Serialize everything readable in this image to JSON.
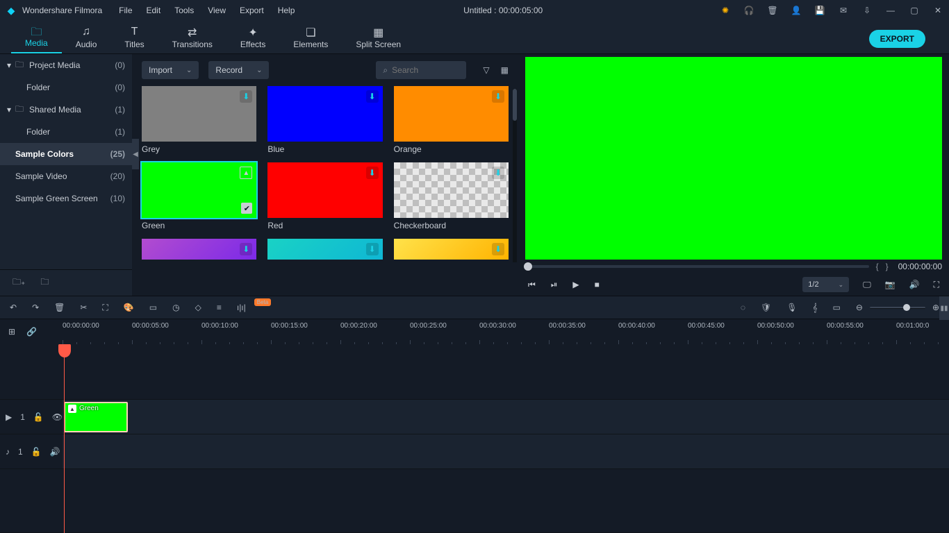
{
  "titlebar": {
    "app_name": "Wondershare Filmora",
    "menu": [
      "File",
      "Edit",
      "Tools",
      "View",
      "Export",
      "Help"
    ],
    "project_title": "Untitled : 00:00:05:00"
  },
  "toptabs": [
    {
      "id": "media",
      "label": "Media",
      "active": true
    },
    {
      "id": "audio",
      "label": "Audio"
    },
    {
      "id": "titles",
      "label": "Titles"
    },
    {
      "id": "transitions",
      "label": "Transitions"
    },
    {
      "id": "effects",
      "label": "Effects"
    },
    {
      "id": "elements",
      "label": "Elements"
    },
    {
      "id": "split",
      "label": "Split Screen"
    }
  ],
  "export_label": "EXPORT",
  "sidebar": {
    "items": [
      {
        "label": "Project Media",
        "count": "(0)",
        "caret": true,
        "folder": true
      },
      {
        "label": "Folder",
        "count": "(0)",
        "child": true
      },
      {
        "label": "Shared Media",
        "count": "(1)",
        "caret": true,
        "folder": true
      },
      {
        "label": "Folder",
        "count": "(1)",
        "child": true
      },
      {
        "label": "Sample Colors",
        "count": "(25)",
        "selected": true
      },
      {
        "label": "Sample Video",
        "count": "(20)"
      },
      {
        "label": "Sample Green Screen",
        "count": "(10)"
      }
    ]
  },
  "mediapanel": {
    "import_label": "Import",
    "record_label": "Record",
    "search_placeholder": "Search",
    "items": [
      {
        "label": "Grey",
        "color": "#808080",
        "dl": true
      },
      {
        "label": "Blue",
        "color": "#0000ff",
        "dl": true
      },
      {
        "label": "Orange",
        "color": "#ff8c00",
        "dl": true
      },
      {
        "label": "Green",
        "color": "#00ff00",
        "selected": true,
        "checked": true,
        "imgic": true
      },
      {
        "label": "Red",
        "color": "#ff0000",
        "dl": true
      },
      {
        "label": "Checkerboard",
        "checker": true,
        "dl": true
      },
      {
        "label": "",
        "gradient": "linear-gradient(135deg,#b24ccf,#7c2ae8)",
        "dl": true,
        "partial": true
      },
      {
        "label": "",
        "gradient": "linear-gradient(135deg,#19d2c5,#0fb7d4)",
        "dl": true,
        "partial": true
      },
      {
        "label": "",
        "gradient": "linear-gradient(135deg,#ffe24a,#ffb300)",
        "dl": true,
        "partial": true
      }
    ]
  },
  "preview": {
    "time": "00:00:00:00",
    "ratio": "1/2"
  },
  "ruler": {
    "marks": [
      "00:00:00:00",
      "00:00:05:00",
      "00:00:10:00",
      "00:00:15:00",
      "00:00:20:00",
      "00:00:25:00",
      "00:00:30:00",
      "00:00:35:00",
      "00:00:40:00",
      "00:00:45:00",
      "00:00:50:00",
      "00:00:55:00",
      "00:01:00:0"
    ]
  },
  "tracks": {
    "video_label": "1",
    "audio_label": "1",
    "clip_label": "Green"
  }
}
